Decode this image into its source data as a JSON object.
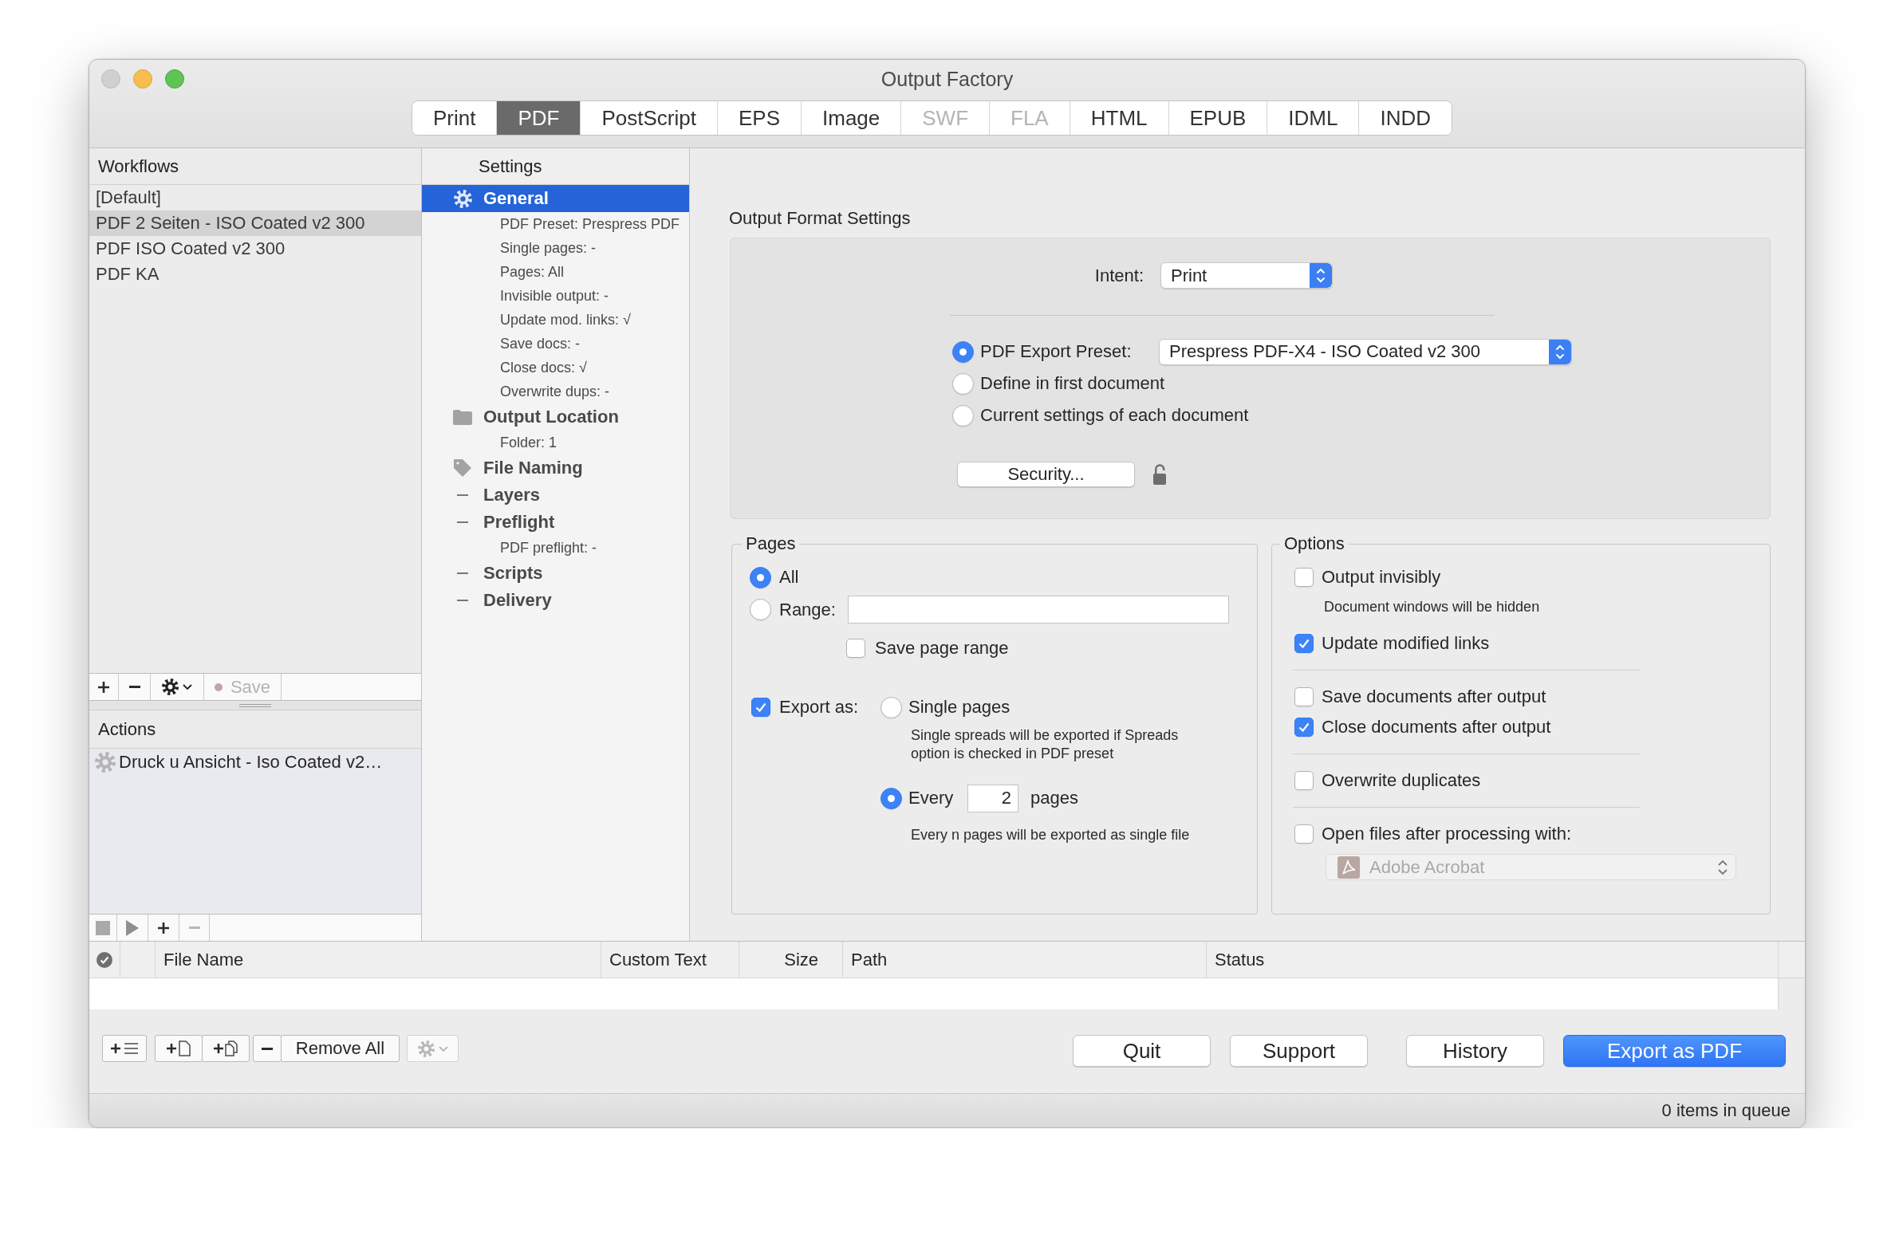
{
  "window": {
    "title": "Output Factory"
  },
  "tabs": [
    {
      "label": "Print",
      "selected": false,
      "disabled": false
    },
    {
      "label": "PDF",
      "selected": true,
      "disabled": false
    },
    {
      "label": "PostScript",
      "selected": false,
      "disabled": false
    },
    {
      "label": "EPS",
      "selected": false,
      "disabled": false
    },
    {
      "label": "Image",
      "selected": false,
      "disabled": false
    },
    {
      "label": "SWF",
      "selected": false,
      "disabled": true
    },
    {
      "label": "FLA",
      "selected": false,
      "disabled": true
    },
    {
      "label": "HTML",
      "selected": false,
      "disabled": false
    },
    {
      "label": "EPUB",
      "selected": false,
      "disabled": false
    },
    {
      "label": "IDML",
      "selected": false,
      "disabled": false
    },
    {
      "label": "INDD",
      "selected": false,
      "disabled": false
    }
  ],
  "workflows": {
    "title": "Workflows",
    "items": [
      {
        "label": "[Default]",
        "selected": false
      },
      {
        "label": "PDF 2 Seiten - ISO Coated v2 300",
        "selected": true
      },
      {
        "label": "PDF ISO Coated v2 300",
        "selected": false
      },
      {
        "label": "PDF KA",
        "selected": false
      }
    ],
    "save_button": {
      "label": "Save",
      "disabled": true
    }
  },
  "actions": {
    "title": "Actions",
    "items": [
      {
        "label": "Druck u Ansicht - Iso Coated v2…"
      }
    ]
  },
  "settings": {
    "title": "Settings",
    "items": [
      {
        "label": "General",
        "kind": "gear",
        "selected": true,
        "children": [
          {
            "label": "PDF Preset: Prespress PDF"
          },
          {
            "label": "Single pages: -"
          },
          {
            "label": "Pages: All"
          },
          {
            "label": "Invisible output: -"
          },
          {
            "label": "Update mod. links: √"
          },
          {
            "label": "Save docs: -"
          },
          {
            "label": "Close docs: √"
          },
          {
            "label": "Overwrite dups: -"
          }
        ]
      },
      {
        "label": "Output Location",
        "kind": "folder",
        "selected": false,
        "children": [
          {
            "label": "Folder: 1"
          }
        ]
      },
      {
        "label": "File Naming",
        "kind": "tag",
        "selected": false
      },
      {
        "label": "Layers",
        "kind": "dash",
        "selected": false
      },
      {
        "label": "Preflight",
        "kind": "dash",
        "selected": false,
        "children": [
          {
            "label": "PDF preflight: -"
          }
        ]
      },
      {
        "label": "Scripts",
        "kind": "dash",
        "selected": false
      },
      {
        "label": "Delivery",
        "kind": "dash",
        "selected": false
      }
    ]
  },
  "output_format": {
    "title": "Output Format Settings",
    "intent": {
      "label": "Intent:",
      "value": "Print"
    },
    "preset_choices": [
      {
        "label": "PDF Export Preset:",
        "selected": true,
        "preset": "Prespress PDF-X4 - ISO Coated v2 300"
      },
      {
        "label": "Define in first document",
        "selected": false
      },
      {
        "label": "Current settings of each document",
        "selected": false
      }
    ],
    "security_button": "Security..."
  },
  "pages": {
    "title": "Pages",
    "all": {
      "label": "All",
      "selected": true
    },
    "range": {
      "label": "Range:",
      "selected": false
    },
    "save_page_range": {
      "label": "Save page range",
      "checked": false
    },
    "export_as": {
      "label": "Export as:",
      "checked": true
    },
    "single_pages": {
      "label": "Single pages",
      "selected": false,
      "note": "Single spreads will be exported if Spreads option is checked in PDF preset"
    },
    "every": {
      "label": "Every",
      "selected": true,
      "value": "2",
      "unit": "pages",
      "note": "Every n pages will be exported as single file"
    }
  },
  "options": {
    "title": "Options",
    "groups": [
      {
        "items": [
          {
            "label": "Output invisibly",
            "checked": false,
            "note": "Document windows will be hidden"
          },
          {
            "label": "Update modified links",
            "checked": true
          }
        ]
      },
      {
        "items": [
          {
            "label": "Save documents after output",
            "checked": false
          },
          {
            "label": "Close documents after output",
            "checked": true
          }
        ]
      },
      {
        "items": [
          {
            "label": "Overwrite duplicates",
            "checked": false
          }
        ]
      },
      {
        "items": [
          {
            "label": "Open files after processing with:",
            "checked": false,
            "app": {
              "value": "Adobe Acrobat",
              "disabled": true
            }
          }
        ]
      }
    ]
  },
  "file_table": {
    "columns": [
      "File Name",
      "Custom Text",
      "Size",
      "Path",
      "Status"
    ]
  },
  "bottom_bar": {
    "remove_all": "Remove All",
    "buttons": [
      {
        "label": "Quit",
        "kind": "normal"
      },
      {
        "label": "Support",
        "kind": "normal"
      },
      {
        "label": "History",
        "kind": "normal"
      },
      {
        "label": "Export as PDF",
        "kind": "primary"
      }
    ]
  },
  "status_bar": {
    "text": "0 items in queue"
  }
}
